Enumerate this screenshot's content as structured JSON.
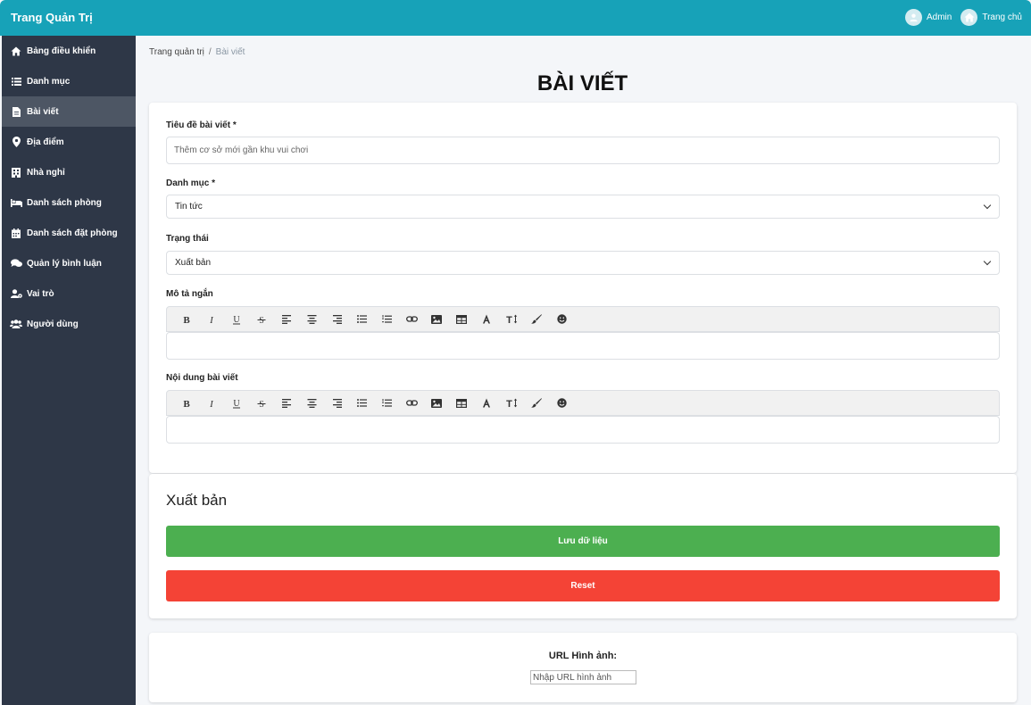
{
  "header": {
    "brand": "Trang Quản Trị",
    "admin_label": "Admin",
    "home_label": "Trang chủ"
  },
  "sidebar": {
    "items": [
      {
        "label": "Bảng điều khiển",
        "icon": "home-icon"
      },
      {
        "label": "Danh mục",
        "icon": "list-icon"
      },
      {
        "label": "Bài viết",
        "icon": "file-icon",
        "active": true
      },
      {
        "label": "Địa điểm",
        "icon": "map-marker-icon"
      },
      {
        "label": "Nhà nghỉ",
        "icon": "building-icon"
      },
      {
        "label": "Danh sách phòng",
        "icon": "bed-icon"
      },
      {
        "label": "Danh sách đặt phòng",
        "icon": "calendar-icon"
      },
      {
        "label": "Quản lý bình luận",
        "icon": "comments-icon"
      },
      {
        "label": "Vai trò",
        "icon": "user-cog-icon"
      },
      {
        "label": "Người dùng",
        "icon": "users-icon"
      }
    ]
  },
  "breadcrumb": {
    "root": "Trang quản trị",
    "separator": "/",
    "current": "Bài viết"
  },
  "page": {
    "title": "BÀI VIẾT"
  },
  "form": {
    "title_label": "Tiêu đề bài viết *",
    "title_placeholder": "Thêm cơ sở mới gần khu vui chơi",
    "category_label": "Danh mục *",
    "category_value": "Tin tức",
    "status_label": "Trạng thái",
    "status_value": "Xuất bản",
    "short_desc_label": "Mô tả ngắn",
    "content_label": "Nội dung bài viết"
  },
  "toolbar_icons": [
    "bold-icon",
    "italic-icon",
    "underline-icon",
    "strikethrough-icon",
    "align-left-icon",
    "align-center-icon",
    "align-right-icon",
    "bullet-list-icon",
    "numbered-list-icon",
    "link-icon",
    "image-icon",
    "table-icon",
    "font-icon",
    "text-height-icon",
    "paint-brush-icon",
    "emoji-icon"
  ],
  "publish": {
    "title": "Xuất bản",
    "save_label": "Lưu dữ liệu",
    "reset_label": "Reset"
  },
  "image_url": {
    "label": "URL Hình ảnh:",
    "placeholder": "Nhập URL hình ảnh"
  },
  "colors": {
    "header": "#17a2b8",
    "sidebar": "#2e3747",
    "sidebar_active": "#4d5664",
    "save": "#4caf50",
    "reset": "#f44336"
  }
}
